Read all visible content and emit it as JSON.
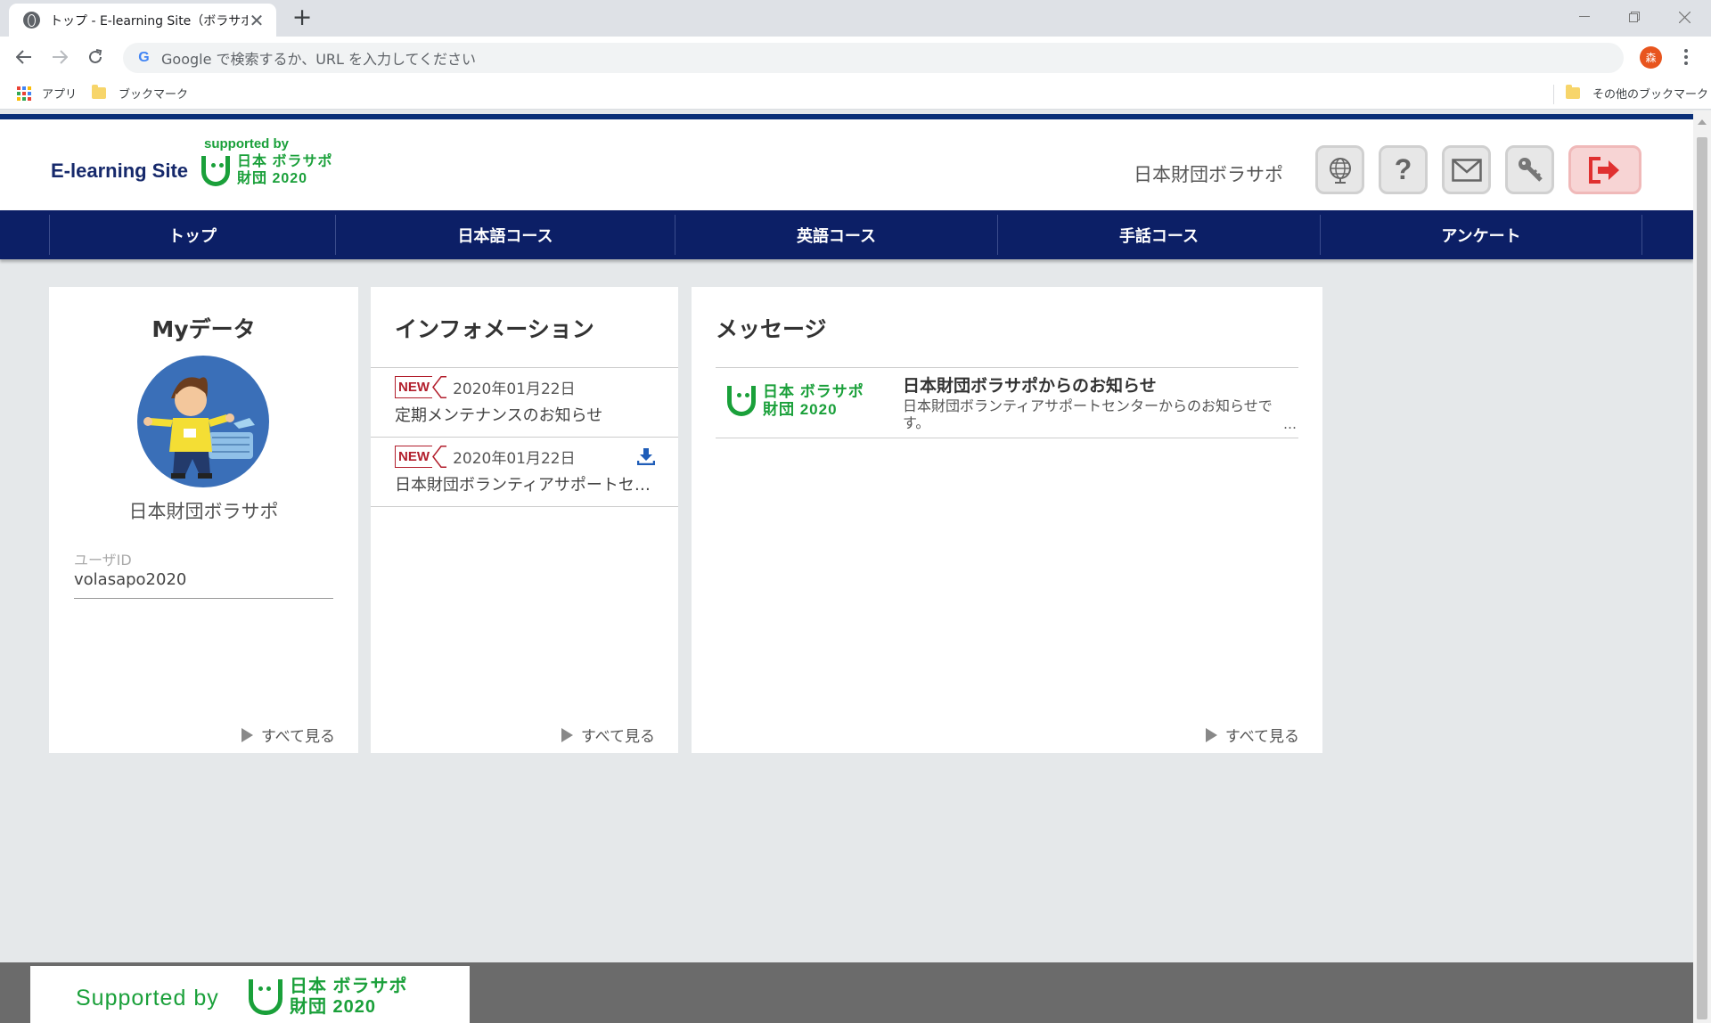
{
  "browser": {
    "tab_title": "トップ - E-learning Site（ボラサポ）",
    "tab_close": "✕",
    "new_tab": "+",
    "omnibox_placeholder": "Google で検索するか、URL を入力してください",
    "profile_initial": "森",
    "bookmarks": {
      "apps": "アプリ",
      "bookmark": "ブックマーク",
      "other": "その他のブックマーク"
    }
  },
  "header": {
    "brand": "E-learning Site",
    "supported_by": "supported by",
    "logo_line1": "日本 ボラサポ",
    "logo_line2": "財団 2020",
    "user_name": "日本財団ボラサポ",
    "buttons": [
      "globe-icon",
      "help-icon",
      "mail-icon",
      "key-icon",
      "logout-icon"
    ],
    "help_glyph": "?"
  },
  "nav": {
    "items": [
      "トップ",
      "日本語コース",
      "英語コース",
      "手話コース",
      "アンケート"
    ]
  },
  "mydata": {
    "title": "Myデータ",
    "name": "日本財団ボラサポ",
    "user_id_label": "ユーザID",
    "user_id": "volasapo2020",
    "see_all": "すべて見る"
  },
  "information": {
    "title": "インフォメーション",
    "new_label": "NEW",
    "items": [
      {
        "date": "2020年01月22日",
        "text": "定期メンテナンスのお知らせ"
      },
      {
        "date": "2020年01月22日",
        "text": "日本財団ボランティアサポートセンターからのお知らせです。"
      }
    ],
    "see_all": "すべて見る"
  },
  "message": {
    "title": "メッセージ",
    "items": [
      {
        "title": "日本財団ボラサポからのお知らせ",
        "body": "日本財団ボランティアサポートセンターからのお知らせです。",
        "more": "…"
      }
    ],
    "see_all": "すべて見る"
  },
  "footer": {
    "supported_by": "Supported by"
  },
  "colors": {
    "nav_bg": "#0c1f66",
    "brand_green": "#1aa03a",
    "new_red": "#b21e2c",
    "footer_bg": "#6b6b6b"
  }
}
